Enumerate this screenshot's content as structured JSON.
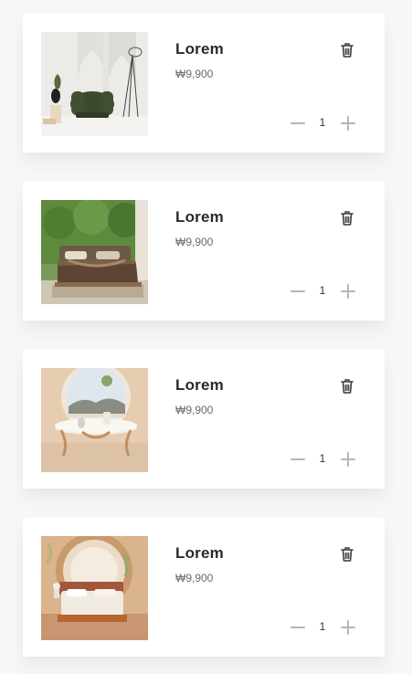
{
  "cart": {
    "items": [
      {
        "name": "Lorem",
        "price": "₩9,900",
        "quantity": "1",
        "image": "green-armchair-photo",
        "delete_icon": "trash-icon",
        "decrement_icon": "minus-icon",
        "increment_icon": "plus-icon"
      },
      {
        "name": "Lorem",
        "price": "₩9,900",
        "quantity": "1",
        "image": "bed-in-forest-room-photo",
        "delete_icon": "trash-icon",
        "decrement_icon": "minus-icon",
        "increment_icon": "plus-icon"
      },
      {
        "name": "Lorem",
        "price": "₩9,900",
        "quantity": "1",
        "image": "round-coffee-table-photo",
        "delete_icon": "trash-icon",
        "decrement_icon": "minus-icon",
        "increment_icon": "plus-icon"
      },
      {
        "name": "Lorem",
        "price": "₩9,900",
        "quantity": "1",
        "image": "arched-bedroom-photo",
        "delete_icon": "trash-icon",
        "decrement_icon": "minus-icon",
        "increment_icon": "plus-icon"
      }
    ]
  },
  "colors": {
    "card_background": "#ffffff",
    "page_background": "#f7f7f7",
    "title_text": "#2a2a2a",
    "price_text": "#6a6a6a",
    "stepper_icon": "#b5b5b5"
  }
}
